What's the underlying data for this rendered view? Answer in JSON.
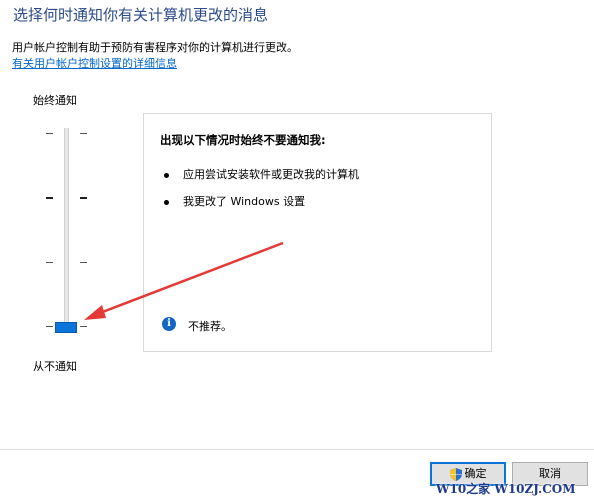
{
  "title": "选择何时通知你有关计算机更改的消息",
  "description": "用户帐户控制有助于预防有害程序对你的计算机进行更改。",
  "link": "有关用户帐户控制设置的详细信息",
  "slider": {
    "top_label": "始终通知",
    "bottom_label": "从不通知",
    "level_index": 0,
    "levels_count": 4
  },
  "info": {
    "heading": "出现以下情况时始终不要通知我:",
    "bullets": [
      "应用尝试安装软件或更改我的计算机",
      "我更改了 Windows 设置"
    ],
    "note": "不推荐。",
    "icon": "info-icon"
  },
  "buttons": {
    "ok": "确定",
    "cancel": "取消"
  },
  "watermark": "W10之家 W10ZJ.COM",
  "colors": {
    "accent": "#0a74da",
    "title": "#2b4a8b",
    "link": "#0066cc",
    "arrow": "#e53935"
  }
}
